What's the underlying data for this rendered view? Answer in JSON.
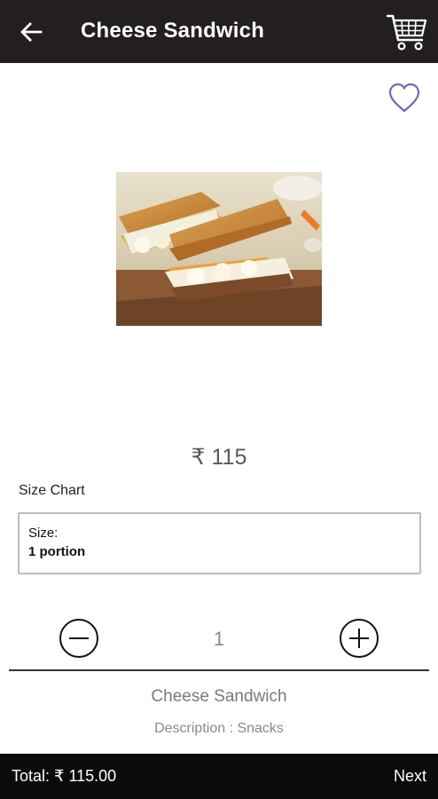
{
  "app_bar": {
    "title": "Cheese Sandwich",
    "back_icon": "arrow-left-icon",
    "cart_icon": "shopping-cart-icon",
    "background": "#231f20"
  },
  "favorite": {
    "icon": "heart-outline-icon",
    "color": "#6f6ab0"
  },
  "product": {
    "image_alt": "Cheese Sandwich",
    "price": "₹ 115",
    "name": "Cheese Sandwich",
    "description": "Description : Snacks"
  },
  "size_chart": {
    "label": "Size Chart",
    "size_label": "Size:",
    "size_value": "1 portion"
  },
  "quantity": {
    "value": "1",
    "decrease_icon": "minus-circle-icon",
    "increase_icon": "plus-circle-icon"
  },
  "footer": {
    "total": "Total: ₹ 115.00",
    "next_label": "Next",
    "background": "#0b0b0b"
  }
}
